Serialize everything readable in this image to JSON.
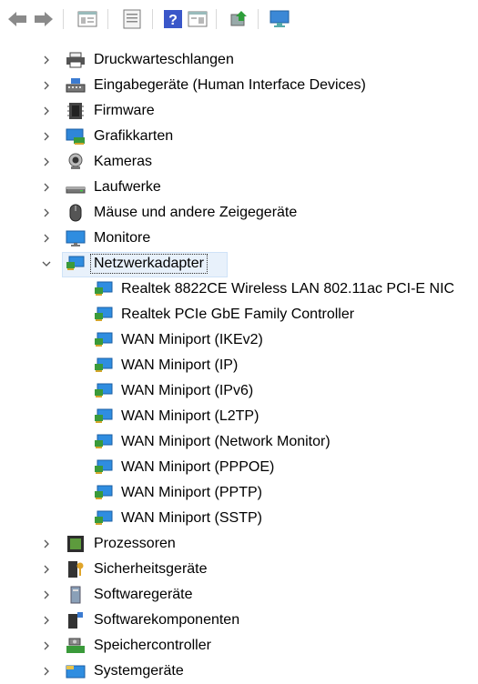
{
  "toolbar": {
    "buttons": [
      {
        "name": "back-icon"
      },
      {
        "name": "forward-icon"
      },
      {
        "name": "show-hide-tree-icon"
      },
      {
        "name": "properties-icon"
      },
      {
        "name": "help-icon"
      },
      {
        "name": "view-panel-icon"
      },
      {
        "name": "update-driver-icon"
      },
      {
        "name": "scan-hardware-icon"
      }
    ]
  },
  "tree": {
    "before": [
      {
        "label": "Druckwarteschlangen",
        "icon": "printer-icon"
      },
      {
        "label": "Eingabegeräte (Human Interface Devices)",
        "icon": "input-device-icon"
      },
      {
        "label": "Firmware",
        "icon": "firmware-icon"
      },
      {
        "label": "Grafikkarten",
        "icon": "display-adapter-icon"
      },
      {
        "label": "Kameras",
        "icon": "camera-icon"
      },
      {
        "label": "Laufwerke",
        "icon": "drive-icon"
      },
      {
        "label": "Mäuse und andere Zeigegeräte",
        "icon": "mouse-icon"
      },
      {
        "label": "Monitore",
        "icon": "monitor-icon"
      }
    ],
    "expanded": {
      "label": "Netzwerkadapter",
      "icon": "network-adapter-icon"
    },
    "children": [
      "Realtek 8822CE Wireless LAN 802.11ac PCI-E NIC",
      "Realtek PCIe GbE Family Controller",
      "WAN Miniport (IKEv2)",
      "WAN Miniport (IP)",
      "WAN Miniport (IPv6)",
      "WAN Miniport (L2TP)",
      "WAN Miniport (Network Monitor)",
      "WAN Miniport (PPPOE)",
      "WAN Miniport (PPTP)",
      "WAN Miniport (SSTP)"
    ],
    "after": [
      {
        "label": "Prozessoren",
        "icon": "processor-icon"
      },
      {
        "label": "Sicherheitsgeräte",
        "icon": "security-device-icon"
      },
      {
        "label": "Softwaregeräte",
        "icon": "software-device-icon"
      },
      {
        "label": "Softwarekomponenten",
        "icon": "software-component-icon"
      },
      {
        "label": "Speichercontroller",
        "icon": "storage-controller-icon"
      },
      {
        "label": "Systemgeräte",
        "icon": "system-device-icon"
      }
    ]
  }
}
